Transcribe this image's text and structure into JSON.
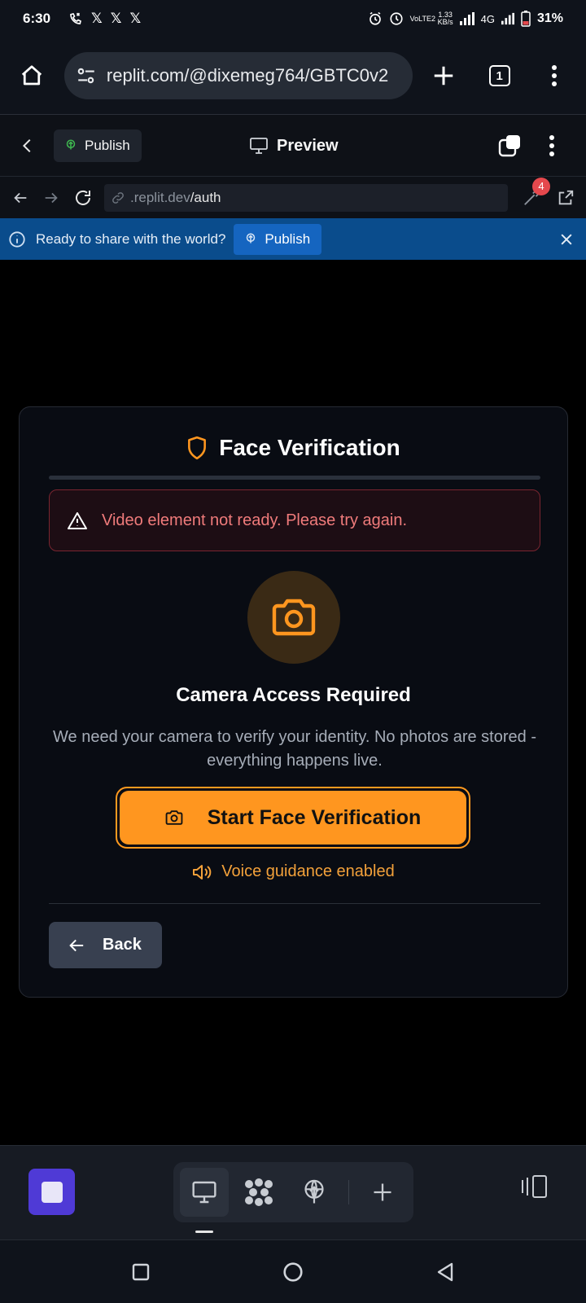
{
  "status_bar": {
    "time": "6:30",
    "net_type": "VoLTE2",
    "net_speed_value": "1.33",
    "net_speed_unit": "KB/s",
    "signal": "4G",
    "battery": "31%"
  },
  "browser": {
    "url": "replit.com/@dixemeg764/GBTC0v2",
    "tab_count": "1"
  },
  "replit_header": {
    "publish_label": "Publish",
    "preview_label": "Preview"
  },
  "address_bar": {
    "domain": ".replit.dev",
    "path": "/auth",
    "devtools_badge": "4"
  },
  "banner": {
    "text": "Ready to share with the world?",
    "publish_label": "Publish"
  },
  "card": {
    "title": "Face Verification",
    "progress": 0,
    "error_message": "Video element not ready. Please try again.",
    "camera_heading": "Camera Access Required",
    "camera_description": "We need your camera to verify your identity. No photos are stored - everything happens live.",
    "start_button": "Start Face Verification",
    "voice_guidance": "Voice guidance enabled",
    "back_button": "Back"
  },
  "colors": {
    "accent_orange": "#ff961f",
    "error_red": "#f07b7b",
    "banner_blue": "#0a4c8c",
    "app_purple": "#4f3ad6"
  }
}
